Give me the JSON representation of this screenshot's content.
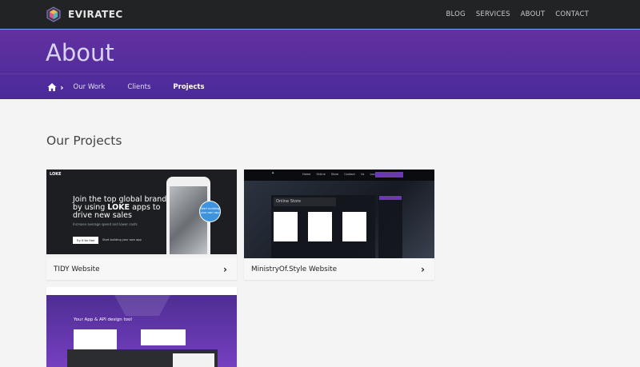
{
  "brand": {
    "name": "EVIRATEC",
    "logo_icon": "hexagon-logo-icon"
  },
  "nav": {
    "items": [
      "BLOG",
      "SERVICES",
      "ABOUT",
      "CONTACT"
    ]
  },
  "hero": {
    "title": "About"
  },
  "breadcrumb": {
    "home_icon": "home-icon",
    "items": [
      "Our Work",
      "Clients",
      "Projects"
    ],
    "active_index": 2
  },
  "section": {
    "title": "Our Projects"
  },
  "projects": [
    {
      "label": "TIDY Website",
      "thumb": {
        "brand": "LOKE",
        "headline_pre": "Join the top global brands by using",
        "headline_bold": "LOKE",
        "headline_post": "apps to drive new sales",
        "sub": "Increase average spend and lower costs",
        "primary_btn": "Try it for free",
        "secondary_btn": "Start building your own app",
        "bubble": "Start building your own app"
      }
    },
    {
      "label": "MinistryOf.Style Website",
      "thumb": {
        "nav": "Home Online Store Contact Us Location",
        "store": "Online Store"
      }
    },
    {
      "label": "",
      "thumb": {
        "tagline": "Your App & API design tool"
      }
    }
  ],
  "colors": {
    "accent": "#5b2fa0",
    "topbar": "#222325",
    "page_bg": "#f4f4f4"
  }
}
